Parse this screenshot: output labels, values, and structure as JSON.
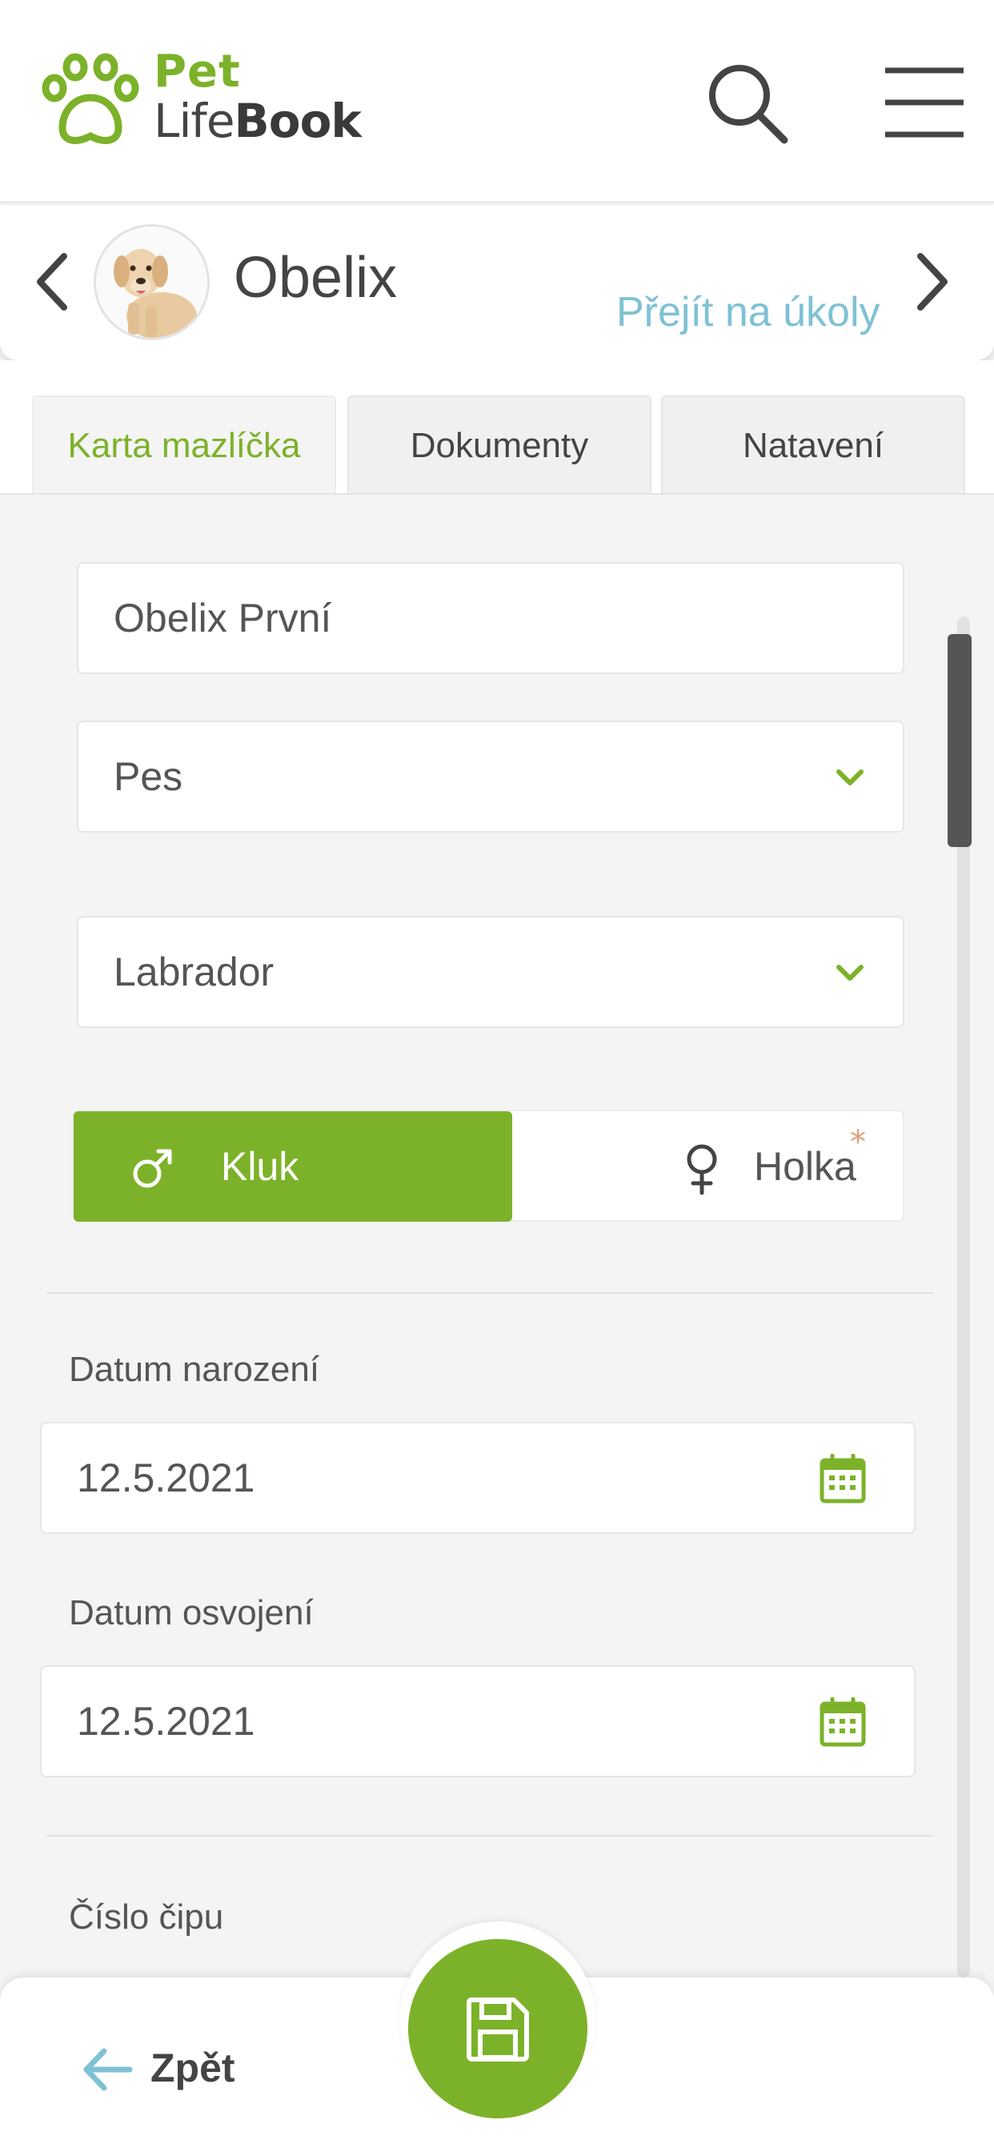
{
  "app": {
    "logo_line1": "Pet",
    "logo_line2_regular": "Life",
    "logo_line2_bold": "Book"
  },
  "pet": {
    "name": "Obelix",
    "tasks_link": "Přejít na úkoly"
  },
  "tabs": [
    {
      "label": "Karta mazlíčka",
      "active": true
    },
    {
      "label": "Dokumenty",
      "active": false
    },
    {
      "label": "Natavení",
      "active": false
    }
  ],
  "form": {
    "full_name": "Obelix První",
    "species": "Pes",
    "breed": "Labrador",
    "gender": {
      "male_label": "Kluk",
      "female_label": "Holka",
      "selected": "male",
      "required_mark": "*"
    },
    "birth_date_label": "Datum narození",
    "birth_date": "12.5.2021",
    "adoption_date_label": "Datum osvojení",
    "adoption_date": "12.5.2021",
    "chip_label": "Číslo čipu"
  },
  "bottom": {
    "back_label": "Zpět"
  },
  "icons": {
    "logo": "paw-icon",
    "search": "search-icon",
    "menu": "hamburger-menu-icon",
    "prev": "chevron-left-icon",
    "next": "chevron-right-icon",
    "dropdown": "chevron-down-icon",
    "male": "male-symbol-icon",
    "female": "female-symbol-icon",
    "calendar": "calendar-icon",
    "back": "arrow-left-icon",
    "save": "floppy-disk-icon"
  },
  "colors": {
    "brand_green": "#7cb229",
    "link_blue": "#7fc1d4",
    "required_orange": "#e0a07a",
    "text_dark": "#444444",
    "background": "#f4f4f4"
  }
}
